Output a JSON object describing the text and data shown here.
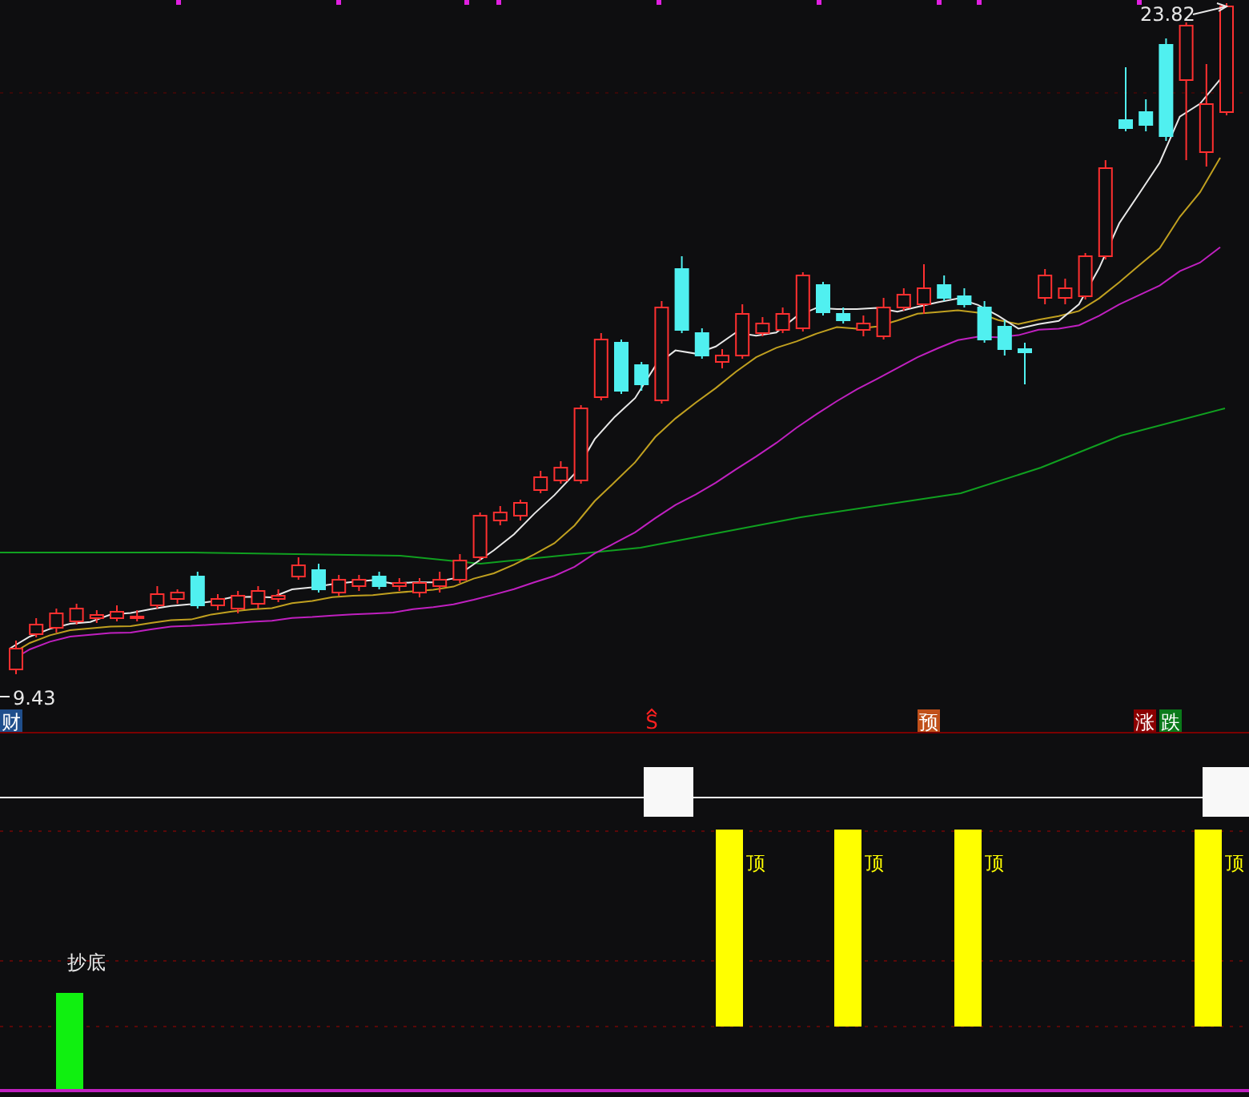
{
  "price_labels": [
    {
      "kind": "high",
      "text": "23.82"
    },
    {
      "kind": "low",
      "text": "9.43"
    }
  ],
  "markers": [
    {
      "text": "财",
      "color": "#1f4e8c"
    },
    {
      "text": "S",
      "color": "#0e0e10"
    },
    {
      "text": "预",
      "color": "#c0501a"
    },
    {
      "text": "涨",
      "color": "#8b0000"
    },
    {
      "text": "跌",
      "color": "#0a7a1a"
    }
  ],
  "top_signals": [
    "顶",
    "顶",
    "顶",
    "顶"
  ],
  "bottom_signal": "抄底"
}
